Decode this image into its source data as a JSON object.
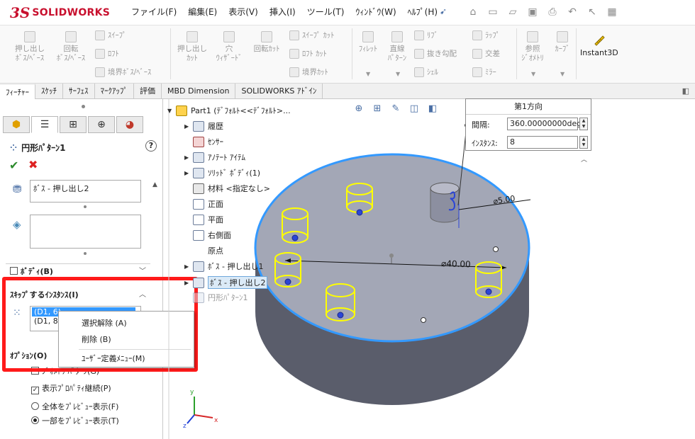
{
  "app": {
    "logo_mark": "3S",
    "logo_text": "SOLIDWORKS",
    "menu": [
      "ファイル(F)",
      "編集(E)",
      "表示(V)",
      "挿入(I)",
      "ツール(T)",
      "ｳｨﾝﾄﾞｳ(W)",
      "ﾍﾙﾌﾟ(H)"
    ],
    "quick_access_icons": [
      "home-icon",
      "new-icon",
      "open-icon",
      "save-icon",
      "print-icon",
      "undo-icon",
      "select-icon",
      "rebuild-icon"
    ]
  },
  "ribbon": {
    "extrude_boss": "押し出し\nﾎﾞｽ/ﾍﾞｰｽ",
    "revolve_boss": "回転\nﾎﾞｽ/ﾍﾞｰｽ",
    "sweep": "ｽｲｰﾌﾟ",
    "loft": "ﾛﾌﾄ",
    "boundary_boss": "境界ﾎﾞｽ/ﾍﾞｰｽ",
    "extrude_cut": "押し出し\nｶｯﾄ",
    "hole_wizard": "穴\nｳｨｻﾞｰﾄﾞ",
    "revolve_cut": "回転ｶｯﾄ",
    "sweep_cut": "ｽｲｰﾌﾟ ｶｯﾄ",
    "loft_cut": "ﾛﾌﾄ ｶｯﾄ",
    "boundary_cut": "境界ｶｯﾄ",
    "fillet": "ﾌｨﾚｯﾄ",
    "linear_pattern": "直線\nﾊﾟﾀｰﾝ",
    "rib": "ﾘﾌﾞ",
    "draft": "抜き勾配",
    "shell": "ｼｪﾙ",
    "wrap": "ﾗｯﾌﾟ",
    "intersect": "交差",
    "mirror": "ﾐﾗｰ",
    "ref_geometry": "参照\nｼﾞｵﾒﾄﾘ",
    "curves": "ｶｰﾌﾞ",
    "instant3d": "Instant3D"
  },
  "tabs": [
    "ﾌｨｰﾁｬｰ",
    "ｽｹｯﾁ",
    "ｻｰﾌｪｽ",
    "ﾏｰｸｱｯﾌﾟ",
    "評価",
    "MBD Dimension",
    "SOLIDWORKS ｱﾄﾞｲﾝ"
  ],
  "property_manager": {
    "title": "円形ﾊﾟﾀｰﾝ1",
    "help": "?",
    "features_list": [
      "ﾎﾞｽ - 押し出し2"
    ],
    "bodies_section": "ﾎﾞﾃﾞｨ(B)",
    "skip_section": "ｽｷｯﾌﾟするｲﾝｽﾀﾝｽ(I)",
    "skip_items": [
      "(D1, 6)",
      "(D1, 8)"
    ],
    "options_section": "ｵﾌﾟｼｮﾝ(O)",
    "opt_geometry_pattern": "ｼﾞｵﾒﾄﾘ ﾊﾟﾀｰﾝ(G)",
    "opt_propagate": "表示ﾌﾟﾛﾊﾟﾃｨ継続(P)",
    "opt_full_preview": "全体をﾌﾟﾚﾋﾞｭｰ表示(F)",
    "opt_partial_preview": "一部をﾌﾟﾚﾋﾞｭｰ表示(T)"
  },
  "context_menu": {
    "deselect": "選択解除 (A)",
    "delete": "削除 (B)",
    "custom": "ﾕｰｻﾞｰ定義ﾒﾆｭｰ(M)"
  },
  "tree": {
    "part": "Part1 (ﾃﾞﾌｫﾙﾄ<<ﾃﾞﾌｫﾙﾄ>...",
    "history": "履歴",
    "sensors": "ｾﾝｻｰ",
    "annotations": "ｱﾉﾃｰﾄ ｱｲﾃﾑ",
    "solid_bodies": "ｿﾘｯﾄﾞ ﾎﾞﾃﾞｨ(1)",
    "material": "材料 <指定なし>",
    "front": "正面",
    "top": "平面",
    "right": "右側面",
    "origin": "原点",
    "boss1": "ﾎﾞｽ - 押し出し1",
    "boss2": "ﾎﾞｽ - 押し出し2",
    "circ_pattern": "円形ﾊﾟﾀｰﾝ1"
  },
  "direction_box": {
    "title": "第1方向",
    "spacing_label": "間隔:",
    "spacing_value": "360.00000000deg",
    "instances_label": "ｲﾝｽﾀﾝｽ:",
    "instances_value": "8"
  },
  "model": {
    "dim_small": "⌀5.00",
    "dim_large": "⌀40.00"
  },
  "colors": {
    "brand": "#c8102e",
    "highlight": "#ff1a1a",
    "selection": "#3399ff",
    "model_top": "#a3a7b6",
    "model_edge": "#3399ff",
    "preview": "#ffff00"
  }
}
